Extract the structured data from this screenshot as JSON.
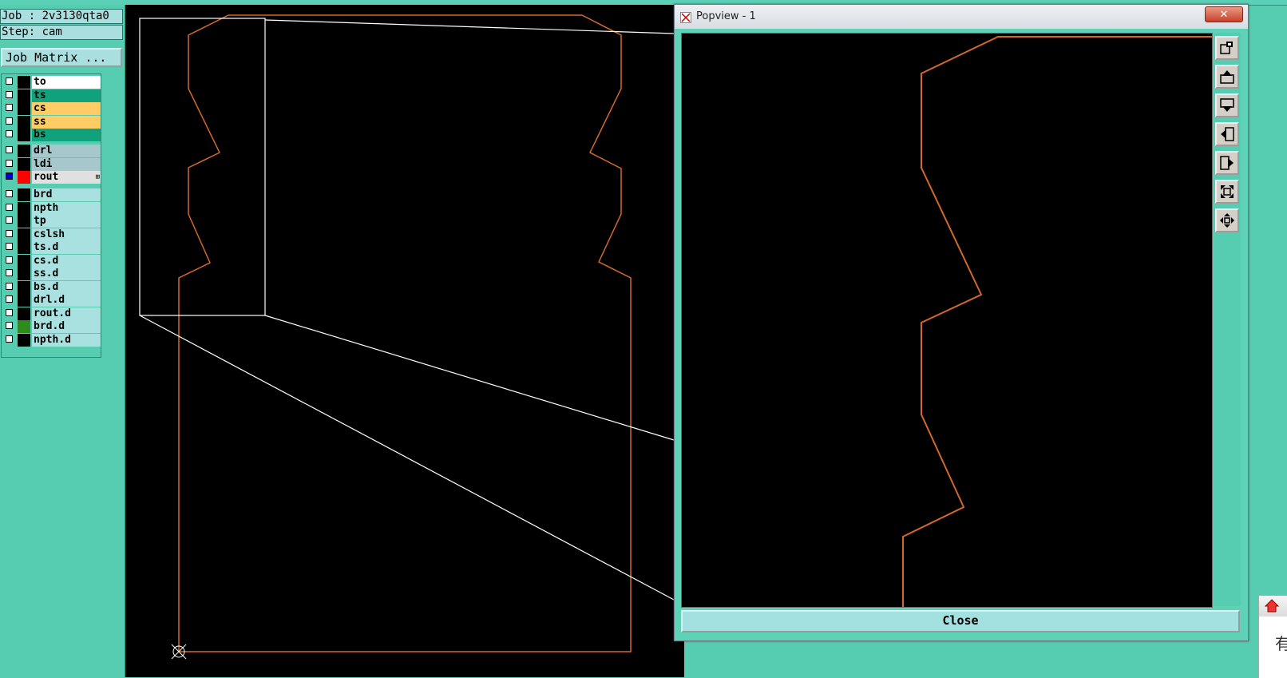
{
  "job": {
    "label": "Job : 2v3130qta0"
  },
  "step": {
    "label": "Step: cam"
  },
  "job_matrix_button": "Job Matrix ...",
  "layers": [
    {
      "name": "to",
      "color": "#ffffff",
      "swatch": "#000000",
      "checked": false
    },
    {
      "name": "ts",
      "color": "#0fa27c",
      "swatch": "#000000",
      "checked": false
    },
    {
      "name": "cs",
      "color": "#ffcc66",
      "swatch": "#000000",
      "checked": false
    },
    {
      "name": "ss",
      "color": "#ffcc66",
      "swatch": "#000000",
      "checked": false
    },
    {
      "name": "bs",
      "color": "#0fa27c",
      "swatch": "#000000",
      "checked": false
    },
    {
      "name": "drl",
      "color": "#a6c8cc",
      "swatch": "#000000",
      "checked": false
    },
    {
      "name": "ldi",
      "color": "#a6c8cc",
      "swatch": "#000000",
      "checked": false
    },
    {
      "name": "rout",
      "color": "#e0e0e0",
      "swatch": "#ff0000",
      "checked": true
    },
    {
      "name": "brd",
      "color": "#a9e0e0",
      "swatch": "#000000",
      "checked": false
    },
    {
      "name": "npth",
      "color": "#a9e0e0",
      "swatch": "#000000",
      "checked": false
    },
    {
      "name": "tp",
      "color": "#a9e0e0",
      "swatch": "#000000",
      "checked": false
    },
    {
      "name": "cslsh",
      "color": "#a9e0e0",
      "swatch": "#000000",
      "checked": false
    },
    {
      "name": "ts.d",
      "color": "#a9e0e0",
      "swatch": "#000000",
      "checked": false
    },
    {
      "name": "cs.d",
      "color": "#a9e0e0",
      "swatch": "#000000",
      "checked": false
    },
    {
      "name": "ss.d",
      "color": "#a9e0e0",
      "swatch": "#000000",
      "checked": false
    },
    {
      "name": "bs.d",
      "color": "#a9e0e0",
      "swatch": "#000000",
      "checked": false
    },
    {
      "name": "drl.d",
      "color": "#a9e0e0",
      "swatch": "#000000",
      "checked": false
    },
    {
      "name": "rout.d",
      "color": "#a9e0e0",
      "swatch": "#000000",
      "checked": false
    },
    {
      "name": "brd.d",
      "color": "#a9e0e0",
      "swatch": "#2e8b1e",
      "checked": false
    },
    {
      "name": "npth.d",
      "color": "#a9e0e0",
      "swatch": "#000000",
      "checked": false
    }
  ],
  "popview": {
    "title": "Popview - 1",
    "close_x": "✕",
    "close_button": "Close",
    "tools": [
      "zoom-window-icon",
      "pan-up-icon",
      "pan-down-icon",
      "pan-left-icon",
      "pan-right-icon",
      "fit-all-icon",
      "zoom-home-icon"
    ]
  },
  "notification": {
    "text": "有"
  },
  "colors": {
    "outline": "#d2692a",
    "zoom_lines": "#ffffff",
    "background": "#56ccb0"
  }
}
